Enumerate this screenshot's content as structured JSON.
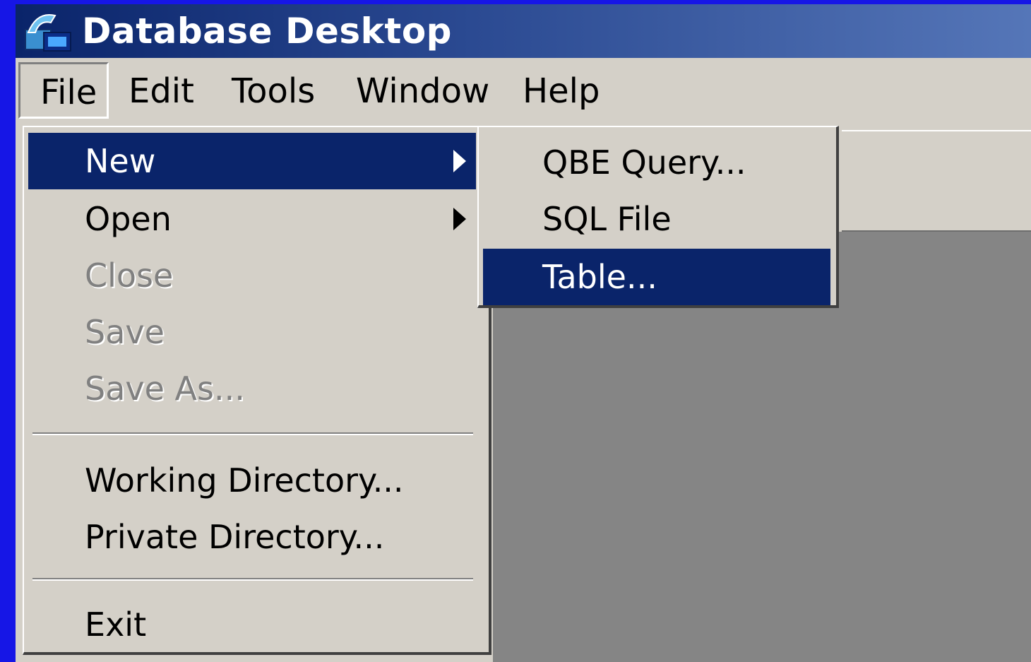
{
  "window": {
    "title": "Database Desktop",
    "icon": "database-desktop-icon"
  },
  "menubar": {
    "items": [
      "File",
      "Edit",
      "Tools",
      "Window",
      "Help"
    ]
  },
  "file_menu": {
    "items": [
      {
        "label": "New",
        "state": "selected",
        "submenu": true
      },
      {
        "label": "Open",
        "state": "enabled",
        "submenu": true
      },
      {
        "label": "Close",
        "state": "disabled"
      },
      {
        "label": "Save",
        "state": "disabled"
      },
      {
        "label": "Save As...",
        "state": "disabled"
      },
      {
        "label": "Working Directory...",
        "state": "enabled"
      },
      {
        "label": "Private Directory...",
        "state": "enabled"
      },
      {
        "label": "Exit",
        "state": "enabled"
      }
    ]
  },
  "new_submenu": {
    "items": [
      {
        "label": "QBE Query...",
        "state": "enabled"
      },
      {
        "label": "SQL File",
        "state": "enabled"
      },
      {
        "label": "Table...",
        "state": "selected"
      }
    ]
  },
  "colors": {
    "selection": "#0a246a",
    "menu_bg": "#d4d0c8",
    "workspace": "#858585",
    "slide_border": "#1616e6"
  }
}
